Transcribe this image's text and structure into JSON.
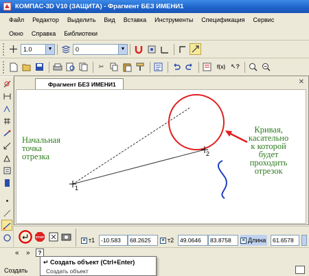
{
  "window": {
    "title": "КОМПАС-3D V10 (ЗАЩИТА) - Фрагмент БЕЗ ИМЕНИ1"
  },
  "menu": {
    "row1": [
      "Файл",
      "Редактор",
      "Выделить",
      "Вид",
      "Вставка",
      "Инструменты",
      "Спецификация",
      "Сервис"
    ],
    "row2": [
      "Окно",
      "Справка",
      "Библиотеки"
    ]
  },
  "toolbar": {
    "line_style_value": "1.0",
    "layer_value": "0",
    "fx_label": "f(x)"
  },
  "document": {
    "tab_title": "Фрагмент БЕЗ ИМЕНИ1"
  },
  "canvas": {
    "annotation_start": [
      "Начальная",
      "точка",
      "отрезка"
    ],
    "annotation_curve": [
      "Кривая,",
      "касательно",
      "к которой",
      "будет",
      "проходить",
      "отрезок"
    ],
    "point1_label": "1",
    "point2_label": "2"
  },
  "properties": {
    "t1_label": "т1",
    "t1_x": "-10.583",
    "t1_y": "68.2625",
    "t2_label": "т2",
    "t2_x": "49.0646",
    "t2_y": "83.8758",
    "length_label": "Длина",
    "length_value": "61.6578",
    "stop_label": "STOP"
  },
  "tooltip": {
    "title": "Создать объект (Ctrl+Enter)",
    "description": "Создать объект"
  },
  "status": {
    "label": "Создать"
  },
  "colors": {
    "title_bar": "#1e62c9",
    "annotation": "#2e7d1e",
    "circle": "#e02020",
    "arrow": "#e02020",
    "curve": "#1a3fc0",
    "highlight": "#e00000"
  },
  "icons": [
    "app-icon",
    "new-doc-icon",
    "open-icon",
    "save-icon",
    "print-icon",
    "cut-icon",
    "copy-icon",
    "paste-icon",
    "undo-icon",
    "redo-icon",
    "zoom-in-icon",
    "zoom-out-icon",
    "create-object-icon",
    "stop-icon",
    "snap-icon",
    "camera-icon"
  ]
}
